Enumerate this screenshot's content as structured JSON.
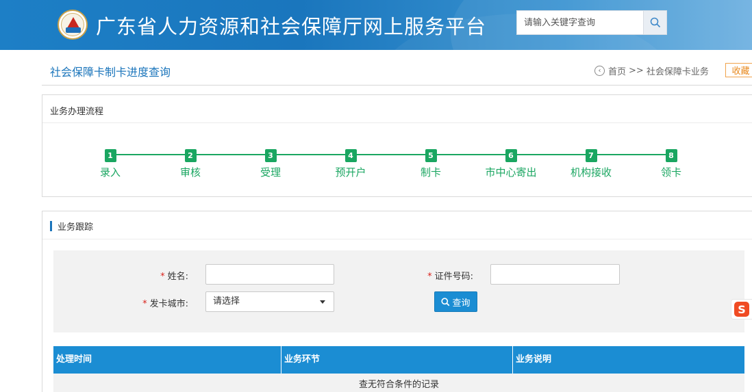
{
  "header": {
    "site_title": "广东省人力资源和社会保障厅网上服务平台",
    "search_placeholder": "请输入关键字查询",
    "logo_icon": "emblem-icon",
    "search_icon": "search-icon"
  },
  "titlebar": {
    "page_title": "社会保障卡制卡进度查询",
    "breadcrumb": {
      "home": "首页",
      "separator": ">>",
      "current": "社会保障卡业务"
    },
    "favorite_label": "收藏"
  },
  "process": {
    "heading": "业务办理流程",
    "steps": [
      {
        "num": "1",
        "label": "录入"
      },
      {
        "num": "2",
        "label": "审核"
      },
      {
        "num": "3",
        "label": "受理"
      },
      {
        "num": "4",
        "label": "预开户"
      },
      {
        "num": "5",
        "label": "制卡"
      },
      {
        "num": "6",
        "label": "市中心寄出"
      },
      {
        "num": "7",
        "label": "机构接收"
      },
      {
        "num": "8",
        "label": "领卡"
      }
    ]
  },
  "tracking": {
    "heading": "业务跟踪",
    "form": {
      "name_label": "姓名:",
      "id_label": "证件号码:",
      "city_label": "发卡城市:",
      "required_mark": "*",
      "name_value": "",
      "id_value": "",
      "city_selected": "请选择",
      "query_label": "查询"
    },
    "table": {
      "columns": [
        "处理时间",
        "业务环节",
        "业务说明"
      ],
      "empty_text": "查无符合条件的记录"
    }
  },
  "colors": {
    "brand_blue": "#1b75bb",
    "step_green": "#1aa661",
    "table_header": "#1b8dd3",
    "favorite_orange": "#e8881c",
    "required_red": "#d9231c"
  }
}
